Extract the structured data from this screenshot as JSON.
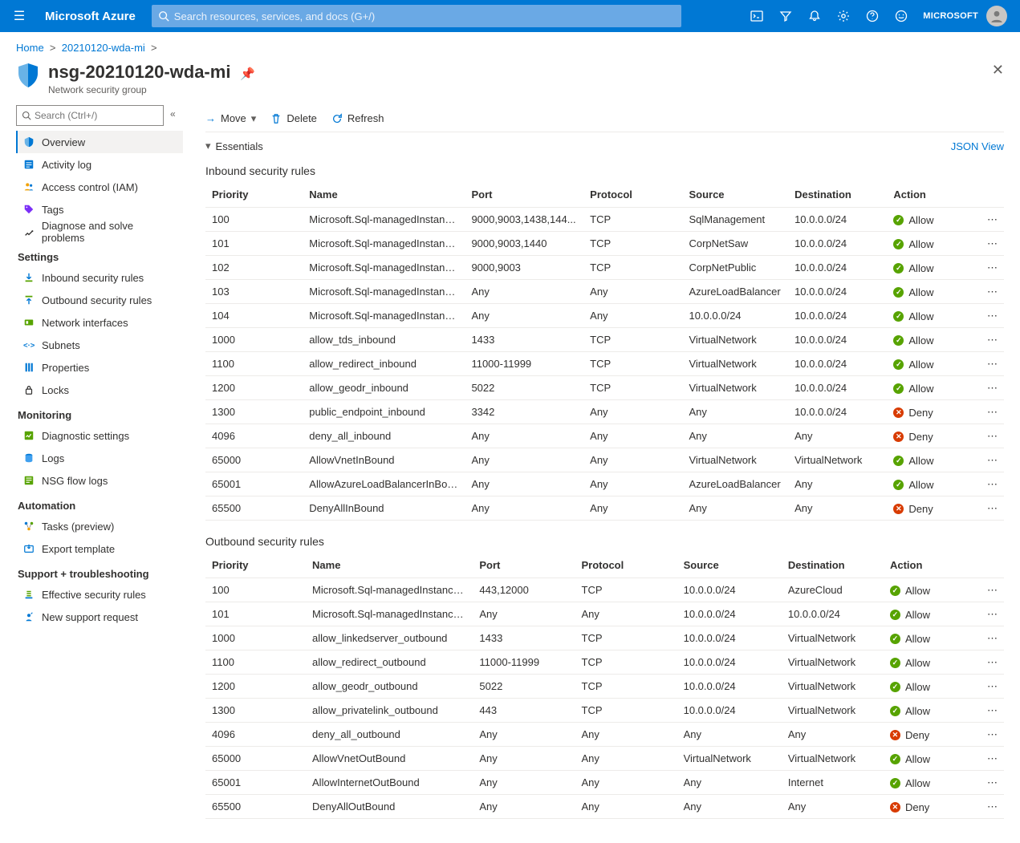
{
  "topbar": {
    "brand": "Microsoft Azure",
    "search_placeholder": "Search resources, services, and docs (G+/)",
    "account": "MICROSOFT"
  },
  "breadcrumb": {
    "home": "Home",
    "parent": "20210120-wda-mi"
  },
  "page": {
    "title": "nsg-20210120-wda-mi",
    "subtitle": "Network security group"
  },
  "sidebar": {
    "search_placeholder": "Search (Ctrl+/)",
    "items_top": [
      {
        "label": "Overview"
      },
      {
        "label": "Activity log"
      },
      {
        "label": "Access control (IAM)"
      },
      {
        "label": "Tags"
      },
      {
        "label": "Diagnose and solve problems"
      }
    ],
    "settings_header": "Settings",
    "items_settings": [
      {
        "label": "Inbound security rules"
      },
      {
        "label": "Outbound security rules"
      },
      {
        "label": "Network interfaces"
      },
      {
        "label": "Subnets"
      },
      {
        "label": "Properties"
      },
      {
        "label": "Locks"
      }
    ],
    "monitoring_header": "Monitoring",
    "items_monitoring": [
      {
        "label": "Diagnostic settings"
      },
      {
        "label": "Logs"
      },
      {
        "label": "NSG flow logs"
      }
    ],
    "automation_header": "Automation",
    "items_automation": [
      {
        "label": "Tasks (preview)"
      },
      {
        "label": "Export template"
      }
    ],
    "support_header": "Support + troubleshooting",
    "items_support": [
      {
        "label": "Effective security rules"
      },
      {
        "label": "New support request"
      }
    ]
  },
  "toolbar": {
    "move": "Move",
    "delete": "Delete",
    "refresh": "Refresh"
  },
  "essentials": {
    "label": "Essentials",
    "json": "JSON View"
  },
  "inbound_title": "Inbound security rules",
  "outbound_title": "Outbound security rules",
  "columns": {
    "priority": "Priority",
    "name": "Name",
    "port": "Port",
    "protocol": "Protocol",
    "source": "Source",
    "destination": "Destination",
    "action": "Action"
  },
  "inbound": [
    {
      "priority": "100",
      "name": "Microsoft.Sql-managedInstances_U...",
      "port": "9000,9003,1438,144...",
      "protocol": "TCP",
      "source": "SqlManagement",
      "destination": "10.0.0.0/24",
      "action": "Allow"
    },
    {
      "priority": "101",
      "name": "Microsoft.Sql-managedInstances_U...",
      "port": "9000,9003,1440",
      "protocol": "TCP",
      "source": "CorpNetSaw",
      "destination": "10.0.0.0/24",
      "action": "Allow"
    },
    {
      "priority": "102",
      "name": "Microsoft.Sql-managedInstances_U...",
      "port": "9000,9003",
      "protocol": "TCP",
      "source": "CorpNetPublic",
      "destination": "10.0.0.0/24",
      "action": "Allow"
    },
    {
      "priority": "103",
      "name": "Microsoft.Sql-managedInstances_U...",
      "port": "Any",
      "protocol": "Any",
      "source": "AzureLoadBalancer",
      "destination": "10.0.0.0/24",
      "action": "Allow"
    },
    {
      "priority": "104",
      "name": "Microsoft.Sql-managedInstances_U...",
      "port": "Any",
      "protocol": "Any",
      "source": "10.0.0.0/24",
      "destination": "10.0.0.0/24",
      "action": "Allow"
    },
    {
      "priority": "1000",
      "name": "allow_tds_inbound",
      "port": "1433",
      "protocol": "TCP",
      "source": "VirtualNetwork",
      "destination": "10.0.0.0/24",
      "action": "Allow"
    },
    {
      "priority": "1100",
      "name": "allow_redirect_inbound",
      "port": "11000-11999",
      "protocol": "TCP",
      "source": "VirtualNetwork",
      "destination": "10.0.0.0/24",
      "action": "Allow"
    },
    {
      "priority": "1200",
      "name": "allow_geodr_inbound",
      "port": "5022",
      "protocol": "TCP",
      "source": "VirtualNetwork",
      "destination": "10.0.0.0/24",
      "action": "Allow"
    },
    {
      "priority": "1300",
      "name": "public_endpoint_inbound",
      "port": "3342",
      "protocol": "Any",
      "source": "Any",
      "destination": "10.0.0.0/24",
      "action": "Deny"
    },
    {
      "priority": "4096",
      "name": "deny_all_inbound",
      "port": "Any",
      "protocol": "Any",
      "source": "Any",
      "destination": "Any",
      "action": "Deny"
    },
    {
      "priority": "65000",
      "name": "AllowVnetInBound",
      "port": "Any",
      "protocol": "Any",
      "source": "VirtualNetwork",
      "destination": "VirtualNetwork",
      "action": "Allow"
    },
    {
      "priority": "65001",
      "name": "AllowAzureLoadBalancerInBound",
      "port": "Any",
      "protocol": "Any",
      "source": "AzureLoadBalancer",
      "destination": "Any",
      "action": "Allow"
    },
    {
      "priority": "65500",
      "name": "DenyAllInBound",
      "port": "Any",
      "protocol": "Any",
      "source": "Any",
      "destination": "Any",
      "action": "Deny"
    }
  ],
  "outbound": [
    {
      "priority": "100",
      "name": "Microsoft.Sql-managedInstances_U...",
      "port": "443,12000",
      "protocol": "TCP",
      "source": "10.0.0.0/24",
      "destination": "AzureCloud",
      "action": "Allow"
    },
    {
      "priority": "101",
      "name": "Microsoft.Sql-managedInstances_U...",
      "port": "Any",
      "protocol": "Any",
      "source": "10.0.0.0/24",
      "destination": "10.0.0.0/24",
      "action": "Allow"
    },
    {
      "priority": "1000",
      "name": "allow_linkedserver_outbound",
      "port": "1433",
      "protocol": "TCP",
      "source": "10.0.0.0/24",
      "destination": "VirtualNetwork",
      "action": "Allow"
    },
    {
      "priority": "1100",
      "name": "allow_redirect_outbound",
      "port": "11000-11999",
      "protocol": "TCP",
      "source": "10.0.0.0/24",
      "destination": "VirtualNetwork",
      "action": "Allow"
    },
    {
      "priority": "1200",
      "name": "allow_geodr_outbound",
      "port": "5022",
      "protocol": "TCP",
      "source": "10.0.0.0/24",
      "destination": "VirtualNetwork",
      "action": "Allow"
    },
    {
      "priority": "1300",
      "name": "allow_privatelink_outbound",
      "port": "443",
      "protocol": "TCP",
      "source": "10.0.0.0/24",
      "destination": "VirtualNetwork",
      "action": "Allow"
    },
    {
      "priority": "4096",
      "name": "deny_all_outbound",
      "port": "Any",
      "protocol": "Any",
      "source": "Any",
      "destination": "Any",
      "action": "Deny"
    },
    {
      "priority": "65000",
      "name": "AllowVnetOutBound",
      "port": "Any",
      "protocol": "Any",
      "source": "VirtualNetwork",
      "destination": "VirtualNetwork",
      "action": "Allow"
    },
    {
      "priority": "65001",
      "name": "AllowInternetOutBound",
      "port": "Any",
      "protocol": "Any",
      "source": "Any",
      "destination": "Internet",
      "action": "Allow"
    },
    {
      "priority": "65500",
      "name": "DenyAllOutBound",
      "port": "Any",
      "protocol": "Any",
      "source": "Any",
      "destination": "Any",
      "action": "Deny"
    }
  ]
}
